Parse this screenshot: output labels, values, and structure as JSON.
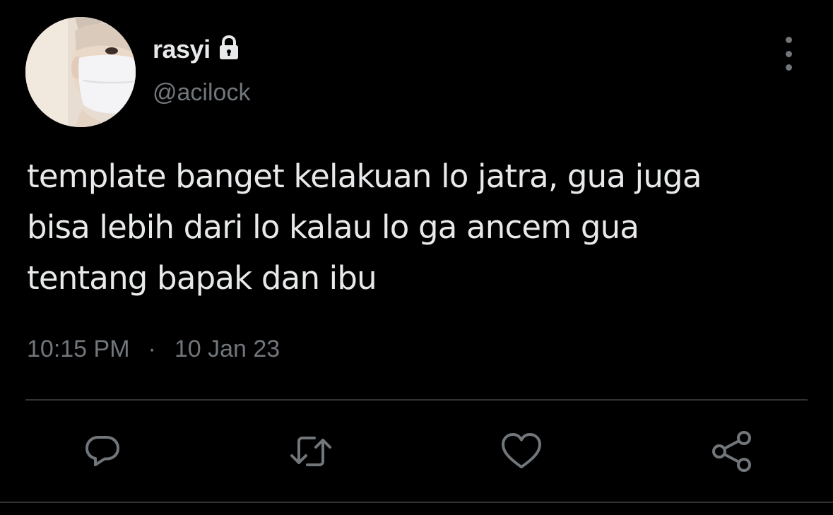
{
  "author": {
    "display_name": "rasyi",
    "handle": "@acilock",
    "protected": true,
    "lock_icon": "lock-icon",
    "avatar_icon": "profile-photo"
  },
  "tweet": {
    "text_lines": [
      "template banget kelakuan lo jatra, gua juga",
      "bisa lebih dari lo kalau lo ga ancem gua",
      "tentang bapak dan ibu"
    ],
    "time": "10:15 PM",
    "separator": "·",
    "date": "10 Jan 23"
  },
  "actions": [
    {
      "name": "reply",
      "icon": "reply-icon"
    },
    {
      "name": "retweet",
      "icon": "retweet-icon"
    },
    {
      "name": "like",
      "icon": "heart-icon"
    },
    {
      "name": "share",
      "icon": "share-icon"
    }
  ],
  "more_icon": "more-vertical-icon",
  "colors": {
    "background": "#000000",
    "primary_text": "#e7e9ea",
    "secondary_text": "#71767b",
    "divider": "#2f3336"
  }
}
